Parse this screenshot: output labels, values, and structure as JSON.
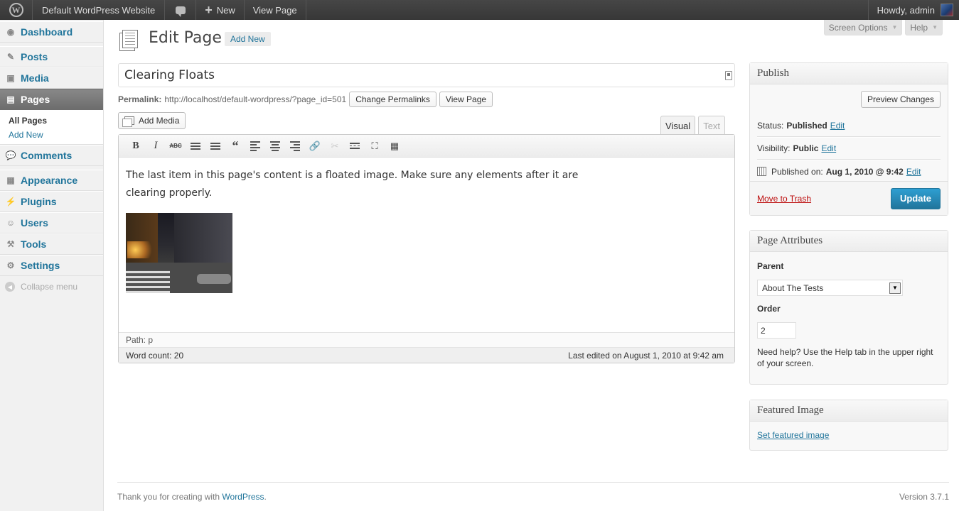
{
  "adminbar": {
    "site_name": "Default WordPress Website",
    "new_label": "New",
    "view_page": "View Page",
    "howdy": "Howdy, admin"
  },
  "menu": {
    "items": [
      {
        "label": "Dashboard",
        "icon": "dashboard-icon"
      },
      {
        "label": "Posts",
        "icon": "pin-icon"
      },
      {
        "label": "Media",
        "icon": "media-icon"
      },
      {
        "label": "Pages",
        "icon": "pages-icon"
      },
      {
        "label": "Comments",
        "icon": "comment-icon"
      },
      {
        "label": "Appearance",
        "icon": "appearance-icon"
      },
      {
        "label": "Plugins",
        "icon": "plug-icon"
      },
      {
        "label": "Users",
        "icon": "users-icon"
      },
      {
        "label": "Tools",
        "icon": "tools-icon"
      },
      {
        "label": "Settings",
        "icon": "settings-icon"
      }
    ],
    "pages_submenu": [
      "All Pages",
      "Add New"
    ],
    "collapse": "Collapse menu"
  },
  "screen_meta": {
    "screen_options": "Screen Options",
    "help": "Help"
  },
  "header": {
    "title": "Edit Page",
    "add_new": "Add New"
  },
  "post": {
    "title": "Clearing Floats",
    "permalink_label": "Permalink:",
    "permalink_url": "http://localhost/default-wordpress/?page_id=501",
    "change_permalinks": "Change Permalinks",
    "view_page": "View Page",
    "add_media": "Add Media"
  },
  "editor": {
    "tab_visual": "Visual",
    "tab_text": "Text",
    "content_line1": "The last item in this page's content is a floated image. Make sure any elements after it are",
    "content_line2": "clearing properly.",
    "toolbar": [
      "B",
      "I",
      "ABC"
    ],
    "path": "Path: p",
    "word_count": "Word count: 20",
    "last_edited": "Last edited on August 1, 2010 at 9:42 am"
  },
  "publish": {
    "title": "Publish",
    "preview": "Preview Changes",
    "status_label": "Status:",
    "status_value": "Published",
    "visibility_label": "Visibility:",
    "visibility_value": "Public",
    "published_on_label": "Published on:",
    "published_on_value": "Aug 1, 2010 @ 9:42",
    "edit": "Edit",
    "trash": "Move to Trash",
    "update": "Update"
  },
  "page_attributes": {
    "title": "Page Attributes",
    "parent_label": "Parent",
    "parent_value": "About The Tests",
    "order_label": "Order",
    "order_value": "2",
    "help_text": "Need help? Use the Help tab in the upper right of your screen."
  },
  "featured": {
    "title": "Featured Image",
    "link": "Set featured image"
  },
  "footer": {
    "thanks_prefix": "Thank you for creating with ",
    "wordpress": "WordPress",
    "thanks_suffix": ".",
    "version": "Version 3.7.1"
  },
  "colors": {
    "accent": "#21759b",
    "current_menu": "#6d6d6d",
    "trash": "#bc0b0b"
  }
}
